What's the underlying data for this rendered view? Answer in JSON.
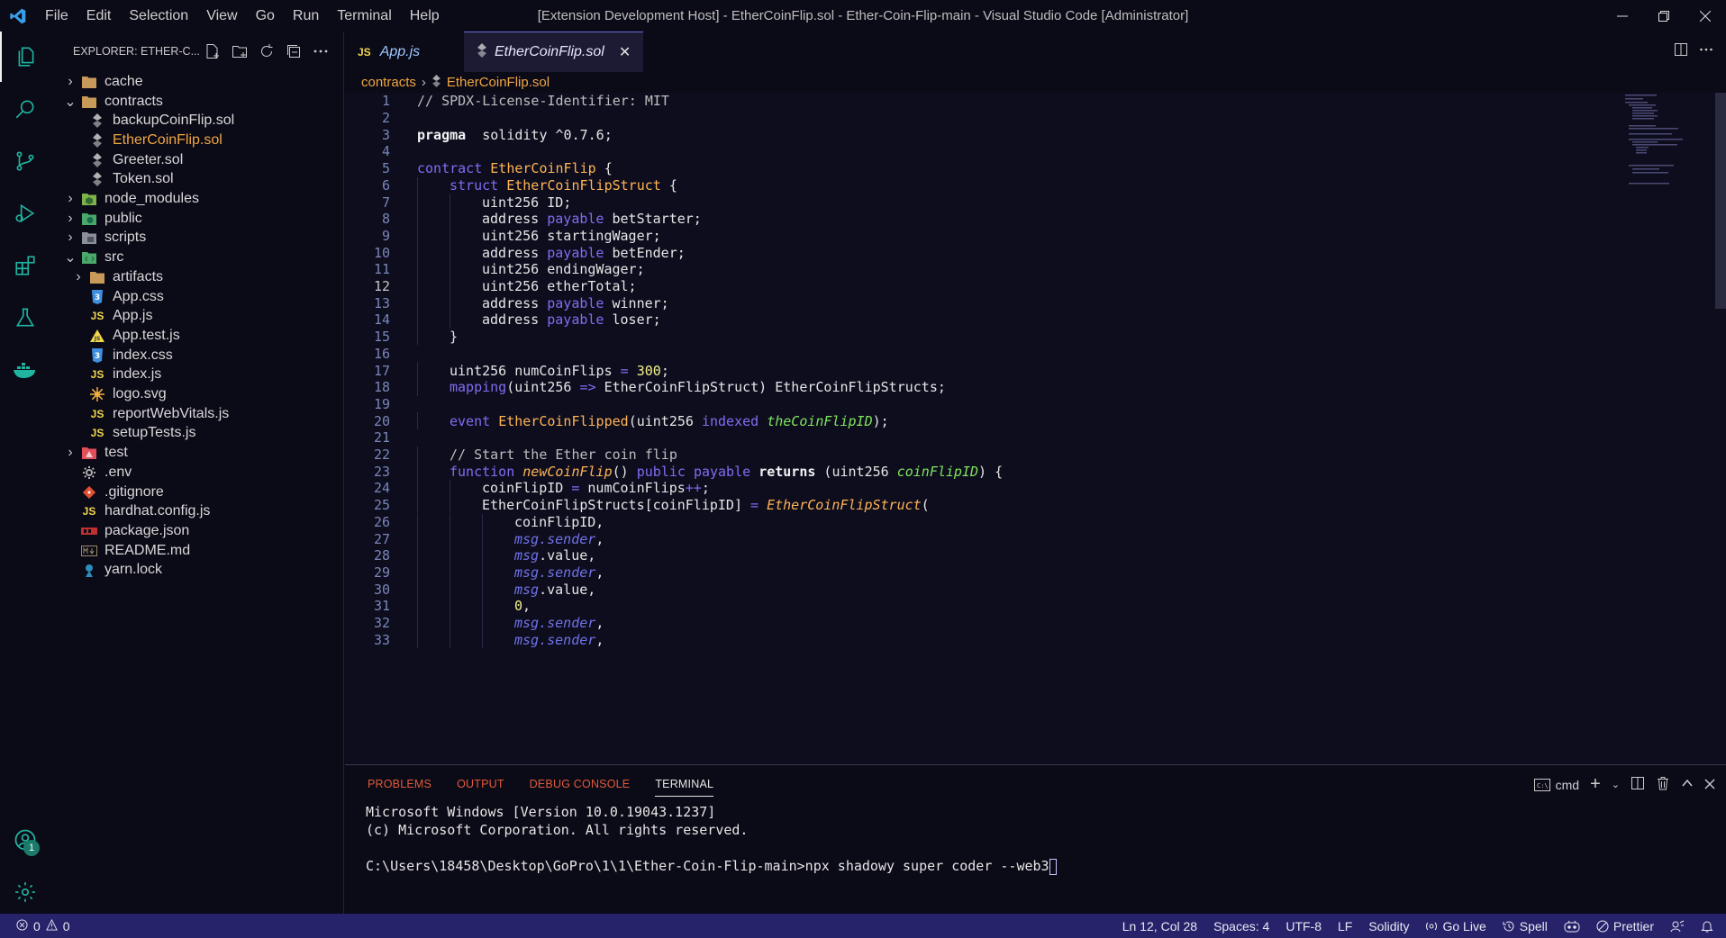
{
  "titlebar": {
    "menu": [
      "File",
      "Edit",
      "Selection",
      "View",
      "Go",
      "Run",
      "Terminal",
      "Help"
    ],
    "window_title": "[Extension Development Host] - EtherCoinFlip.sol - Ether-Coin-Flip-main - Visual Studio Code [Administrator]"
  },
  "activity": {
    "accounts_badge": "1"
  },
  "sidebar": {
    "title": "EXPLORER: ETHER-C...",
    "tree": [
      {
        "label": "cache",
        "type": "folder",
        "open": false,
        "depth": 0,
        "icon": "folder"
      },
      {
        "label": "contracts",
        "type": "folder",
        "open": true,
        "depth": 0,
        "icon": "folder"
      },
      {
        "label": "backupCoinFlip.sol",
        "type": "file",
        "depth": 1,
        "icon": "sol"
      },
      {
        "label": "EtherCoinFlip.sol",
        "type": "file",
        "depth": 1,
        "icon": "sol",
        "modified": true
      },
      {
        "label": "Greeter.sol",
        "type": "file",
        "depth": 1,
        "icon": "sol"
      },
      {
        "label": "Token.sol",
        "type": "file",
        "depth": 1,
        "icon": "sol"
      },
      {
        "label": "node_modules",
        "type": "folder",
        "open": false,
        "depth": 0,
        "icon": "node"
      },
      {
        "label": "public",
        "type": "folder",
        "open": false,
        "depth": 0,
        "icon": "public"
      },
      {
        "label": "scripts",
        "type": "folder",
        "open": false,
        "depth": 0,
        "icon": "scripts"
      },
      {
        "label": "src",
        "type": "folder",
        "open": true,
        "depth": 0,
        "icon": "src"
      },
      {
        "label": "artifacts",
        "type": "folder",
        "open": false,
        "depth": 1,
        "icon": "folder"
      },
      {
        "label": "App.css",
        "type": "file",
        "depth": 1,
        "icon": "css"
      },
      {
        "label": "App.js",
        "type": "file",
        "depth": 1,
        "icon": "js"
      },
      {
        "label": "App.test.js",
        "type": "file",
        "depth": 1,
        "icon": "test"
      },
      {
        "label": "index.css",
        "type": "file",
        "depth": 1,
        "icon": "css"
      },
      {
        "label": "index.js",
        "type": "file",
        "depth": 1,
        "icon": "js"
      },
      {
        "label": "logo.svg",
        "type": "file",
        "depth": 1,
        "icon": "svg"
      },
      {
        "label": "reportWebVitals.js",
        "type": "file",
        "depth": 1,
        "icon": "js"
      },
      {
        "label": "setupTests.js",
        "type": "file",
        "depth": 1,
        "icon": "js"
      },
      {
        "label": "test",
        "type": "folder",
        "open": false,
        "depth": 0,
        "icon": "testfolder"
      },
      {
        "label": ".env",
        "type": "file",
        "depth": 0,
        "icon": "gear"
      },
      {
        "label": ".gitignore",
        "type": "file",
        "depth": 0,
        "icon": "git"
      },
      {
        "label": "hardhat.config.js",
        "type": "file",
        "depth": 0,
        "icon": "js"
      },
      {
        "label": "package.json",
        "type": "file",
        "depth": 0,
        "icon": "npm"
      },
      {
        "label": "README.md",
        "type": "file",
        "depth": 0,
        "icon": "md"
      },
      {
        "label": "yarn.lock",
        "type": "file",
        "depth": 0,
        "icon": "yarn"
      }
    ]
  },
  "editor": {
    "tabs": [
      {
        "label": "App.js",
        "badge": "JS",
        "active": false
      },
      {
        "label": "EtherCoinFlip.sol",
        "active": true
      }
    ],
    "breadcrumb": [
      "contracts",
      "EtherCoinFlip.sol"
    ],
    "current_line": 12,
    "lines": [
      {
        "n": 1,
        "i": 0,
        "t": [
          [
            "cmt",
            "// SPDX-License-Identifier: MIT"
          ]
        ]
      },
      {
        "n": 2,
        "i": 0,
        "t": []
      },
      {
        "n": 3,
        "i": 0,
        "t": [
          [
            "bold",
            "pragma"
          ],
          [
            "",
            "  solidity ^0.7.6;"
          ]
        ]
      },
      {
        "n": 4,
        "i": 0,
        "t": []
      },
      {
        "n": 5,
        "i": 0,
        "t": [
          [
            "kw",
            "contract"
          ],
          [
            "",
            " "
          ],
          [
            "fn",
            "EtherCoinFlip"
          ],
          [
            "",
            " {"
          ]
        ]
      },
      {
        "n": 6,
        "i": 1,
        "t": [
          [
            "kw",
            "struct"
          ],
          [
            "",
            " "
          ],
          [
            "fn",
            "EtherCoinFlipStruct"
          ],
          [
            "",
            " {"
          ]
        ]
      },
      {
        "n": 7,
        "i": 2,
        "t": [
          [
            "",
            "uint256 ID;"
          ]
        ]
      },
      {
        "n": 8,
        "i": 2,
        "t": [
          [
            "",
            "address "
          ],
          [
            "kw",
            "payable"
          ],
          [
            "",
            " betStarter;"
          ]
        ]
      },
      {
        "n": 9,
        "i": 2,
        "t": [
          [
            "",
            "uint256 startingWager;"
          ]
        ]
      },
      {
        "n": 10,
        "i": 2,
        "t": [
          [
            "",
            "address "
          ],
          [
            "kw",
            "payable"
          ],
          [
            "",
            " betEnder;"
          ]
        ]
      },
      {
        "n": 11,
        "i": 2,
        "t": [
          [
            "",
            "uint256 endingWager;"
          ]
        ]
      },
      {
        "n": 12,
        "i": 2,
        "t": [
          [
            "",
            "uint256 etherTotal;"
          ]
        ]
      },
      {
        "n": 13,
        "i": 2,
        "t": [
          [
            "",
            "address "
          ],
          [
            "kw",
            "payable"
          ],
          [
            "",
            " winner;"
          ]
        ]
      },
      {
        "n": 14,
        "i": 2,
        "t": [
          [
            "",
            "address "
          ],
          [
            "kw",
            "payable"
          ],
          [
            "",
            " loser;"
          ]
        ]
      },
      {
        "n": 15,
        "i": 1,
        "t": [
          [
            "",
            "}"
          ]
        ]
      },
      {
        "n": 16,
        "i": 0,
        "t": []
      },
      {
        "n": 17,
        "i": 1,
        "t": [
          [
            "",
            "uint256 numCoinFlips "
          ],
          [
            "op",
            "="
          ],
          [
            "",
            " "
          ],
          [
            "num",
            "300"
          ],
          [
            "",
            ";"
          ]
        ]
      },
      {
        "n": 18,
        "i": 1,
        "t": [
          [
            "kw",
            "mapping"
          ],
          [
            "",
            "(uint256 "
          ],
          [
            "op",
            "=>"
          ],
          [
            "",
            " EtherCoinFlipStruct) EtherCoinFlipStructs;"
          ]
        ]
      },
      {
        "n": 19,
        "i": 0,
        "t": []
      },
      {
        "n": 20,
        "i": 1,
        "t": [
          [
            "kw",
            "event"
          ],
          [
            "",
            " "
          ],
          [
            "fn",
            "EtherCoinFlipped"
          ],
          [
            "",
            "(uint256 "
          ],
          [
            "kw",
            "indexed"
          ],
          [
            "",
            " "
          ],
          [
            "param",
            "theCoinFlipID"
          ],
          [
            "",
            ");"
          ]
        ]
      },
      {
        "n": 21,
        "i": 0,
        "t": []
      },
      {
        "n": 22,
        "i": 1,
        "t": [
          [
            "cmt",
            "// Start the Ether coin flip"
          ]
        ]
      },
      {
        "n": 23,
        "i": 1,
        "t": [
          [
            "kw",
            "function"
          ],
          [
            "",
            " "
          ],
          [
            "ifn",
            "newCoinFlip"
          ],
          [
            "",
            "() "
          ],
          [
            "kw",
            "public"
          ],
          [
            "",
            " "
          ],
          [
            "kw",
            "payable"
          ],
          [
            "",
            " "
          ],
          [
            "bold",
            "returns"
          ],
          [
            "",
            " (uint256 "
          ],
          [
            "param",
            "coinFlipID"
          ],
          [
            "",
            ") {"
          ]
        ]
      },
      {
        "n": 24,
        "i": 2,
        "t": [
          [
            "",
            "coinFlipID "
          ],
          [
            "op",
            "="
          ],
          [
            "",
            " numCoinFlips"
          ],
          [
            "op",
            "++"
          ],
          [
            "",
            ";"
          ]
        ]
      },
      {
        "n": 25,
        "i": 2,
        "t": [
          [
            "",
            "EtherCoinFlipStructs[coinFlipID] "
          ],
          [
            "op",
            "="
          ],
          [
            "",
            " "
          ],
          [
            "it2",
            "EtherCoinFlipStruct"
          ],
          [
            "",
            "("
          ]
        ]
      },
      {
        "n": 26,
        "i": 3,
        "t": [
          [
            "",
            "coinFlipID,"
          ]
        ]
      },
      {
        "n": 27,
        "i": 3,
        "t": [
          [
            "it",
            "msg.sender"
          ],
          [
            "",
            ","
          ]
        ]
      },
      {
        "n": 28,
        "i": 3,
        "t": [
          [
            "it",
            "msg"
          ],
          [
            "",
            ".value,"
          ]
        ]
      },
      {
        "n": 29,
        "i": 3,
        "t": [
          [
            "it",
            "msg.sender"
          ],
          [
            "",
            ","
          ]
        ]
      },
      {
        "n": 30,
        "i": 3,
        "t": [
          [
            "it",
            "msg"
          ],
          [
            "",
            ".value,"
          ]
        ]
      },
      {
        "n": 31,
        "i": 3,
        "t": [
          [
            "num",
            "0"
          ],
          [
            "",
            ","
          ]
        ]
      },
      {
        "n": 32,
        "i": 3,
        "t": [
          [
            "it",
            "msg.sender"
          ],
          [
            "",
            ","
          ]
        ]
      },
      {
        "n": 33,
        "i": 3,
        "t": [
          [
            "it",
            "msg.sender"
          ],
          [
            "",
            ","
          ]
        ]
      }
    ]
  },
  "panel": {
    "tabs": [
      "PROBLEMS",
      "OUTPUT",
      "DEBUG CONSOLE",
      "TERMINAL"
    ],
    "active_tab": "TERMINAL",
    "shell": "cmd",
    "terminal_lines": [
      "Microsoft Windows [Version 10.0.19043.1237]",
      "(c) Microsoft Corporation. All rights reserved.",
      "",
      "C:\\Users\\18458\\Desktop\\GoPro\\1\\1\\Ether-Coin-Flip-main>npx shadowy super coder --web3"
    ]
  },
  "statusbar": {
    "errors": "0",
    "warnings": "0",
    "position": "Ln 12, Col 28",
    "spaces": "Spaces: 4",
    "encoding": "UTF-8",
    "eol": "LF",
    "language": "Solidity",
    "golive": "Go Live",
    "spell": "Spell",
    "prettier": "Prettier"
  },
  "colors": {
    "accent": "#26236a",
    "modified": "#f0a642",
    "keyword": "#7f6df2",
    "function": "#ffb454"
  }
}
